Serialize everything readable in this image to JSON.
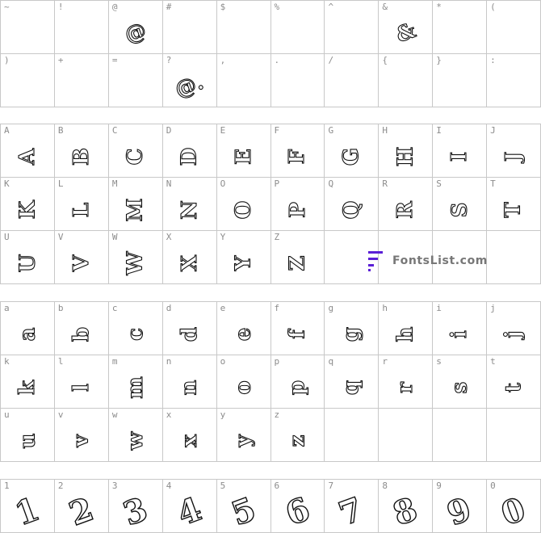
{
  "symbols": {
    "row1": [
      {
        "label": "~",
        "glyph": ""
      },
      {
        "label": "!",
        "glyph": ""
      },
      {
        "label": "@",
        "glyph": "@"
      },
      {
        "label": "#",
        "glyph": ""
      },
      {
        "label": "$",
        "glyph": ""
      },
      {
        "label": "%",
        "glyph": ""
      },
      {
        "label": "^",
        "glyph": ""
      },
      {
        "label": "&",
        "glyph": "&"
      },
      {
        "label": "*",
        "glyph": ""
      },
      {
        "label": "(",
        "glyph": ""
      }
    ],
    "row2": [
      {
        "label": ")",
        "glyph": ""
      },
      {
        "label": "+",
        "glyph": ""
      },
      {
        "label": "=",
        "glyph": ""
      },
      {
        "label": "?",
        "glyph": "@."
      },
      {
        "label": ",",
        "glyph": ""
      },
      {
        "label": ".",
        "glyph": ""
      },
      {
        "label": "/",
        "glyph": ""
      },
      {
        "label": "{",
        "glyph": ""
      },
      {
        "label": "}",
        "glyph": ""
      },
      {
        "label": ":",
        "glyph": ""
      }
    ]
  },
  "uppercase": {
    "row1": [
      "A",
      "B",
      "C",
      "D",
      "E",
      "F",
      "G",
      "H",
      "I",
      "J"
    ],
    "row2": [
      "K",
      "L",
      "M",
      "N",
      "O",
      "P",
      "Q",
      "R",
      "S",
      "T"
    ],
    "row3": [
      "U",
      "V",
      "W",
      "X",
      "Y",
      "Z"
    ]
  },
  "lowercase": {
    "row1": [
      "a",
      "b",
      "c",
      "d",
      "e",
      "f",
      "g",
      "h",
      "i",
      "j"
    ],
    "row2": [
      "k",
      "l",
      "m",
      "n",
      "o",
      "p",
      "q",
      "r",
      "s",
      "t"
    ],
    "row3": [
      "u",
      "v",
      "w",
      "x",
      "y",
      "z"
    ]
  },
  "digits": [
    "1",
    "2",
    "3",
    "4",
    "5",
    "6",
    "7",
    "8",
    "9",
    "0"
  ],
  "watermark": {
    "text": "FontsList.com",
    "accent": "#5b1fd6"
  }
}
